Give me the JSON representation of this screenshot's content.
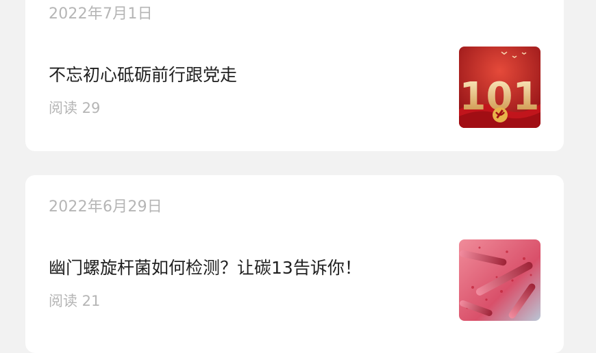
{
  "articles": [
    {
      "date": "2022年7月1日",
      "title": "不忘初心砥砺前行跟党走",
      "reads": "阅读 29",
      "thumbnail_text": "101",
      "thumbnail_icon": "party-emblem-icon",
      "colors": {
        "bg": "#b3151c",
        "gold": "#f0c070"
      }
    },
    {
      "date": "2022年6月29日",
      "title": "幽门螺旋杆菌如何检测？让碳13告诉你！",
      "reads": "阅读 21",
      "thumbnail_icon": "bacteria-image",
      "colors": {
        "bg": "#e06a7e",
        "accent": "#9d2236"
      }
    }
  ]
}
